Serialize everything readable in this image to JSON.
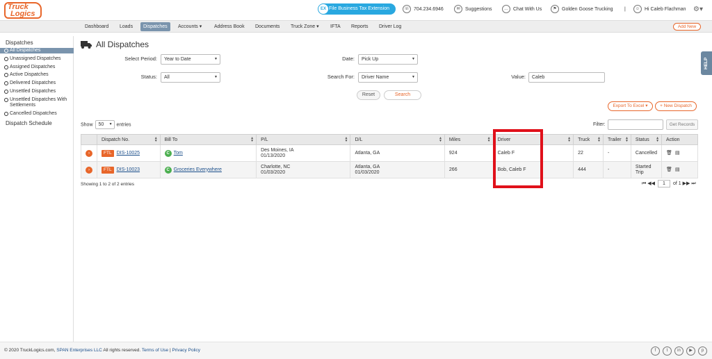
{
  "app": {
    "logo_line1": "Truck",
    "logo_line2": "Logics"
  },
  "topbar": {
    "tax_button": "File Business Tax Extension",
    "tax_icon": "EX",
    "phone": "704.234.6946",
    "suggestions": "Suggestions",
    "chat": "Chat With Us",
    "company": "Golden Goose Trucking",
    "separator": "|",
    "user": "Hi Caleb Flachman"
  },
  "nav": {
    "items": [
      "Dashboard",
      "Loads",
      "Dispatches",
      "Accounts ▾",
      "Address Book",
      "Documents",
      "Truck Zone ▾",
      "IFTA",
      "Reports",
      "Driver Log"
    ],
    "active_index": 2,
    "add_new": "Add New"
  },
  "sidebar": {
    "section1": "Dispatches",
    "items": [
      "All Dispatches",
      "Unassigned Dispatches",
      "Assigned Dispatches",
      "Active Dispatches",
      "Delivered Dispatches",
      "Unsettled Dispatches",
      "Unsettled Dispatches With Settlements",
      "Cancelled Dispatches"
    ],
    "section2": "Dispatch Schedule"
  },
  "page": {
    "title": "All Dispatches"
  },
  "filters": {
    "select_period_label": "Select Period:",
    "select_period_value": "Year to Date",
    "date_label": "Date:",
    "date_value": "Pick Up",
    "status_label": "Status:",
    "status_value": "All",
    "search_for_label": "Search For:",
    "search_for_value": "Driver Name",
    "value_label": "Value:",
    "value_value": "Caleb",
    "reset": "Reset",
    "search": "Search"
  },
  "actions": {
    "export": "Export To Excel ▾",
    "new_dispatch": "+ New Dispatch"
  },
  "table_controls": {
    "show": "Show",
    "entries_value": "50",
    "entries": "entries",
    "filter": "Filter:",
    "get_records": "Get Records"
  },
  "table": {
    "headers": [
      "",
      "Dispatch No.",
      "Bill To",
      "P/L",
      "D/L",
      "Miles",
      "Driver",
      "Truck",
      "Trailer",
      "Status",
      "Action"
    ],
    "rows": [
      {
        "type": "FTL",
        "dispatch": "DIS-10025",
        "bill_icon": "C",
        "bill_to": "Tom",
        "pl_city": "Des Moines, IA",
        "pl_date": "01/13/2020",
        "dl_city": "Atlanta, GA",
        "dl_date": "",
        "miles": "924",
        "driver": "Caleb F",
        "truck": "22",
        "trailer": "-",
        "status": "Cancelled"
      },
      {
        "type": "FTL",
        "dispatch": "DIS-10023",
        "bill_icon": "C",
        "bill_to": "Groceries Everywhere",
        "pl_city": "Charlotte, NC",
        "pl_date": "01/03/2020",
        "dl_city": "Atlanta, GA",
        "dl_date": "01/03/2020",
        "miles": "266",
        "driver": "Bob, Caleb F",
        "truck": "444",
        "trailer": "-",
        "status": "Started Trip"
      }
    ],
    "showing": "Showing 1 to 2 of 2 entries",
    "page_value": "1",
    "page_of": "of 1"
  },
  "help": "HELP",
  "footer": {
    "copyright": "© 2020 TruckLogics.com,",
    "span": "SPAN Enterprises LLC",
    "rights": "All rights reserved.",
    "terms": "Terms of Use",
    "sep": "|",
    "privacy": "Privacy Policy"
  },
  "colors": {
    "accent": "#e8662a",
    "nav_active": "#7a94ad",
    "link": "#1a4e8a",
    "highlight": "#e0101a",
    "tax_button": "#29a8e0"
  }
}
